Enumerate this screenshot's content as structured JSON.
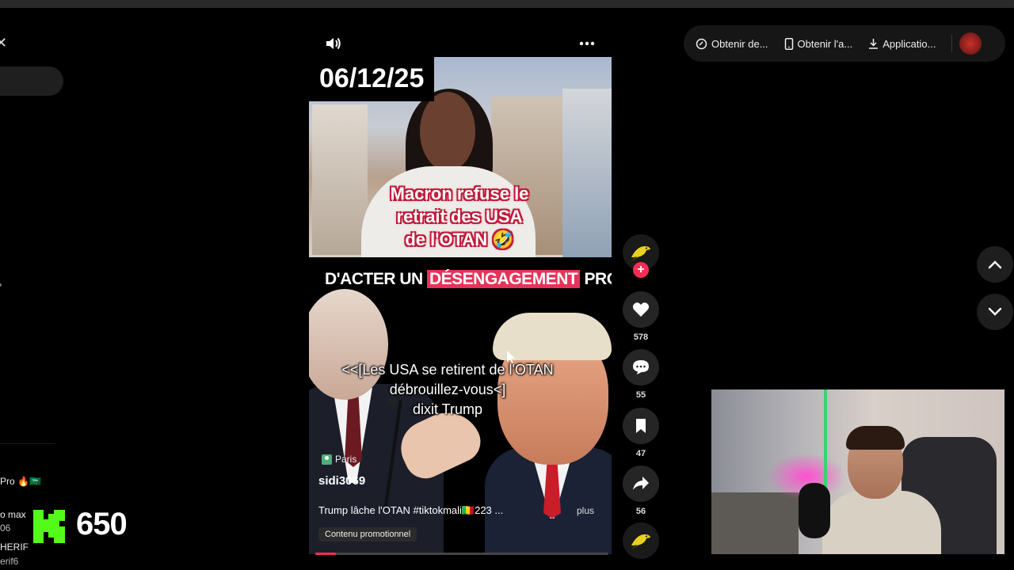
{
  "video": {
    "date_badge": "06/12/25",
    "caption_top": [
      "Macron refuse le",
      "retrait des USA",
      "de l'OTAN 🤣"
    ],
    "headline_pre": "D'ACTER UN ",
    "headline_highlight": "DÉSENGAGEMENT",
    "headline_post": " PROGRES",
    "caption_bottom": [
      "<<[Les USA se retirent de l'OTAN",
      "débrouillez-vous<]",
      "dixit Trump"
    ],
    "location": "Paris",
    "author": "sidi3069",
    "description": "Trump lâche l'OTAN #tiktokmali🇲🇱223 ...",
    "more_label": "plus",
    "promo_label": "Contenu promotionnel",
    "progress": 0.07
  },
  "actions": {
    "likes": "578",
    "comments": "55",
    "saves": "47",
    "shares": "56"
  },
  "toolbar": {
    "item1": "Obtenir de...",
    "item2": "Obtenir l'a...",
    "item3": "Applicatio..."
  },
  "chat": {
    "line1": "Pro 🔥🇸🇦",
    "line2": "o max",
    "line3": "06",
    "line4": "HERIF",
    "line5": "erif6"
  },
  "kick": {
    "count": "650"
  },
  "icons": {
    "accent": "#fe2c55",
    "kick_green": "#53fc18"
  }
}
